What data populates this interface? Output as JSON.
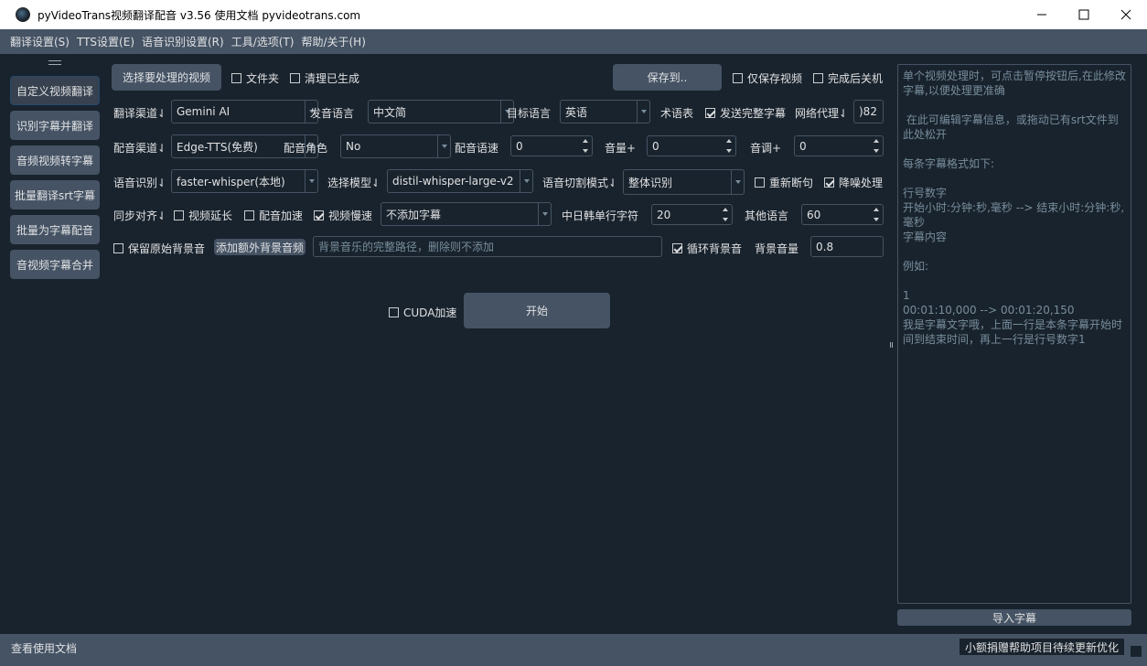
{
  "window": {
    "title": "pyVideoTrans视频翻译配音 v3.56  使用文档  pyvideotrans.com"
  },
  "menu": [
    "翻译设置(S)",
    "TTS设置(E)",
    "语音识别设置(R)",
    "工具/选项(T)",
    "帮助/关于(H)"
  ],
  "sidebar": {
    "items": [
      {
        "label": "自定义视频翻译"
      },
      {
        "label": "识别字幕并翻译"
      },
      {
        "label": "音频视频转字幕"
      },
      {
        "label": "批量翻译srt字幕"
      },
      {
        "label": "批量为字幕配音"
      },
      {
        "label": "音视频字幕合并"
      }
    ]
  },
  "row1": {
    "select_video": "选择要处理的视频",
    "folder": "文件夹",
    "clear_generated": "清理已生成",
    "save_to": "保存到..",
    "only_save_video": "仅保存视频",
    "shutdown_after": "完成后关机"
  },
  "row2": {
    "translate_channel_label": "翻译渠道⇃",
    "translate_channel": "Gemini AI",
    "source_lang_label": "发音语言",
    "source_lang": "中文简",
    "target_lang_label": "目标语言",
    "target_lang": "英语",
    "glossary": "术语表",
    "send_full_subtitle": "发送完整字幕",
    "proxy_label": "网络代理⇃",
    "proxy_value": ")82"
  },
  "row3": {
    "tts_channel_label": "配音渠道⇃",
    "tts_channel": "Edge-TTS(免费)",
    "voice_role_label": "配音角色",
    "voice_role": "No",
    "voice_rate_label": "配音语速",
    "voice_rate": "0",
    "volume_label": "音量+",
    "volume": "0",
    "pitch_label": "音调+",
    "pitch": "0"
  },
  "row4": {
    "asr_label": "语音识别⇃",
    "asr_engine": "faster-whisper(本地)",
    "model_label": "选择模型⇃",
    "model": "distil-whisper-large-v2",
    "split_mode_label": "语音切割模式⇃",
    "split_mode": "整体识别",
    "resegment": "重新断句",
    "denoise": "降噪处理"
  },
  "row5": {
    "sync_label": "同步对齐⇃",
    "video_extend": "视频延长",
    "voice_speedup": "配音加速",
    "video_slowdown": "视频慢速",
    "subtitle_mode": "不添加字幕",
    "cjk_chars_label": "中日韩单行字符",
    "cjk_chars": "20",
    "other_lang_label": "其他语言",
    "other_lang": "60"
  },
  "row6": {
    "keep_bgm": "保留原始背景音",
    "add_bgm": "添加额外背景音频",
    "bgm_placeholder": "背景音乐的完整路径，删除则不添加",
    "loop_bgm": "循环背景音",
    "bgm_volume_label": "背景音量",
    "bgm_volume": "0.8"
  },
  "run": {
    "cuda": "CUDA加速",
    "start": "开始"
  },
  "subtitle_panel": {
    "placeholder": "单个视频处理时，可点击暂停按钮后,在此修改字幕,以便处理更准确\n\n 在此可编辑字幕信息，或拖动已有srt文件到此处松开\n\n每条字幕格式如下:\n\n行号数字\n开始小时:分钟:秒,毫秒 --> 结束小时:分钟:秒,毫秒\n字幕内容\n\n例如:\n\n1\n00:01:10,000 --> 00:01:20,150\n我是字幕文字哦，上面一行是本条字幕开始时间到结束时间，再上一行是行号数字1",
    "import_button": "导入字幕"
  },
  "status": {
    "left": "查看使用文档",
    "right": "小额捐赠帮助项目待续更新优化"
  },
  "colors": {
    "background": "#19232d",
    "panel": "#455364",
    "text": "#e0e1e3",
    "muted": "#788d9c"
  }
}
